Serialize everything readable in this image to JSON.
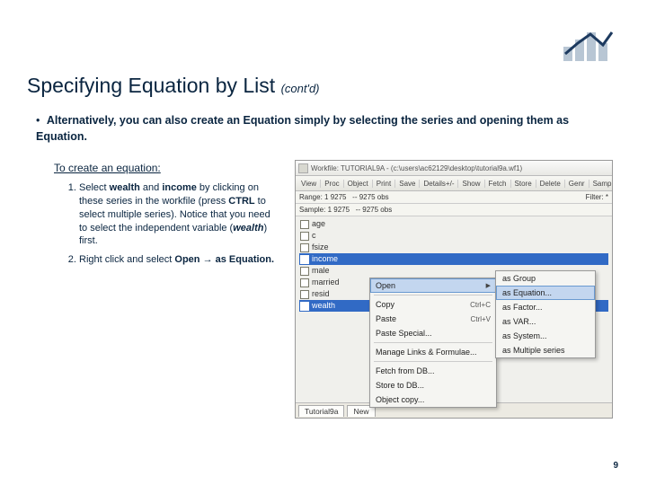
{
  "title": "Specifying Equation by List",
  "title_suffix": "(cont'd)",
  "main_bullet_prefix": "Alternatively, you can also create an Equation simply by selecting the series and opening them as Equation.",
  "sub_heading": "To create an equation:",
  "step1_a": "Select ",
  "step1_b": "wealth",
  "step1_c": " and ",
  "step1_d": "income",
  "step1_e": " by clicking on these series in the workfile (press ",
  "step1_f": "CTRL",
  "step1_g": " to select multiple series). Notice that you need to select the independent variable (",
  "step1_h": "wealth",
  "step1_i": ") first.",
  "step2_a": "Right click and select ",
  "step2_b": "Open",
  "step2_c": " → ",
  "step2_d": "as Equation.",
  "ss": {
    "wf_title": "Workfile: TUTORIAL9A - (c:\\users\\ac62129\\desktop\\tutorial9a.wf1)",
    "toolbar": [
      "View",
      "Proc",
      "Object",
      "Print",
      "Save",
      "Details+/-",
      "Show",
      "Fetch",
      "Store",
      "Delete",
      "Genr",
      "Sample"
    ],
    "range_label": "Range: 1 9275",
    "obs_label": "-- 9275 obs",
    "filter_label": "Filter: *",
    "sample_label": "Sample: 1 9275",
    "sample_obs": "-- 9275 obs",
    "series": [
      "age",
      "c",
      "fsize",
      "income",
      "male",
      "married",
      "resid",
      "wealth"
    ],
    "tab": "Tutorial9a",
    "tab_new": "New"
  },
  "ctx": {
    "open": "Open",
    "copy": "Copy",
    "copy_sc": "Ctrl+C",
    "paste": "Paste",
    "paste_sc": "Ctrl+V",
    "paste_special": "Paste Special...",
    "manage": "Manage Links & Formulae...",
    "fetch": "Fetch from DB...",
    "store": "Store to DB...",
    "objcopy": "Object copy..."
  },
  "sub": {
    "group": "as Group",
    "equation": "as Equation...",
    "factor": "as Factor...",
    "var": "as VAR...",
    "system": "as System...",
    "multiple": "as Multiple series"
  },
  "page_num": "9"
}
